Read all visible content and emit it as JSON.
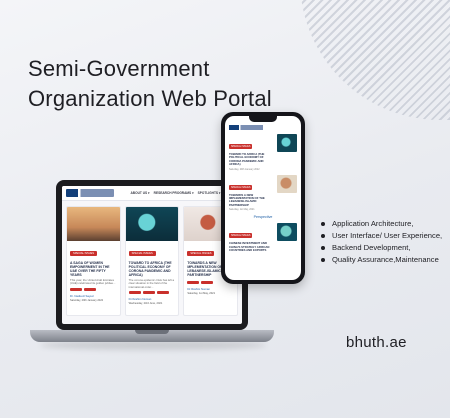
{
  "headline": {
    "line1": "Semi-Government",
    "line2": "Organization Web Portal"
  },
  "laptop_site": {
    "menu": [
      "ABOUT US ▾",
      "RESEARCH PROGRAMS ▾",
      "SPOTLIGHTS ▾",
      "SEARCH"
    ],
    "cards": [
      {
        "tag": "SPECIAL ISSUES",
        "headline": "A SAGA OF WOMEN EMPOWERMENT IN THE UAE OVER THE FIFTY YEARS",
        "text": "This year, the United Arab Emirates (UAE) celebrated its golden jubilee...",
        "author": "Dr. Nadia Al Sayed",
        "date": "Saturday, 29th January 2022"
      },
      {
        "tag": "SPECIAL ISSUES",
        "headline": "TOWARD TO AFRICA (THE POLITICAL ECONOMY OF CORONA PANDEMIC AND AFRICA)",
        "text": "The corona epidemic crisis has left a clear situation in the field of the international order...",
        "author": "Dr.Ibrahim Noman",
        "date": "Wednesday, 23rd June, 2021"
      },
      {
        "tag": "SPECIAL ISSUES",
        "headline": "TOWARDS A NEW MPLEMENTATION OF THE LEBANESE-ISLAMIC PARTNERSHIP",
        "text": "",
        "author": "Dr.Ibrahim Noman",
        "date": "Saturday, 1st May, 2021"
      }
    ]
  },
  "phone_site": {
    "items": [
      {
        "tag": "SPECIAL ISSUES",
        "headline": "TOWARD TO AFRICA (THE POLITICAL ECONOMY OF CORONA PANDEMIC AND AFRICA)",
        "date": "Saturday, 29th January 2022"
      },
      {
        "tag": "SPECIAL ISSUES",
        "headline": "TOWARDS A NEW IMPLEMENTATION OF THE LEBANESE-ISLAMIC PARTNERSHIP",
        "date": "Saturday, 1st May, 2021"
      }
    ],
    "section": "Perspective",
    "last_item": {
      "tag": "SPECIAL ISSUES",
      "headline": "CHINESE INVESTMENT AND CHINA'S STRATEGY AFRICAN COUNTRIES AND EXPORTS"
    }
  },
  "features": [
    "Application Architecture,",
    "User Interface/ User Experience,",
    "Backend Development,",
    "Quality Assurance,Maintenance"
  ],
  "domain_text": "bhuth.ae"
}
